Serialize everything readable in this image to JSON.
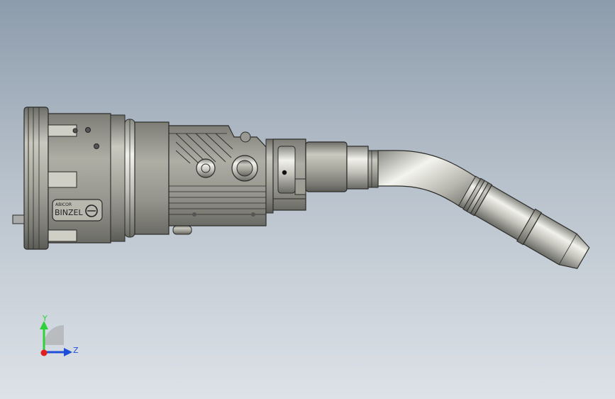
{
  "viewport": {
    "label": "CAD 3D model viewport",
    "model": {
      "brand_line1": "ABICOR",
      "brand_line2": "BINZEL"
    }
  },
  "triad": {
    "y_label": "Y",
    "z_label": "Z"
  },
  "colors": {
    "bg_top": "#8d9cac",
    "bg_bottom": "#dde2e8",
    "axis_y": "#2fd13a",
    "axis_z": "#1f4fd8",
    "axis_x": "#e02020"
  }
}
